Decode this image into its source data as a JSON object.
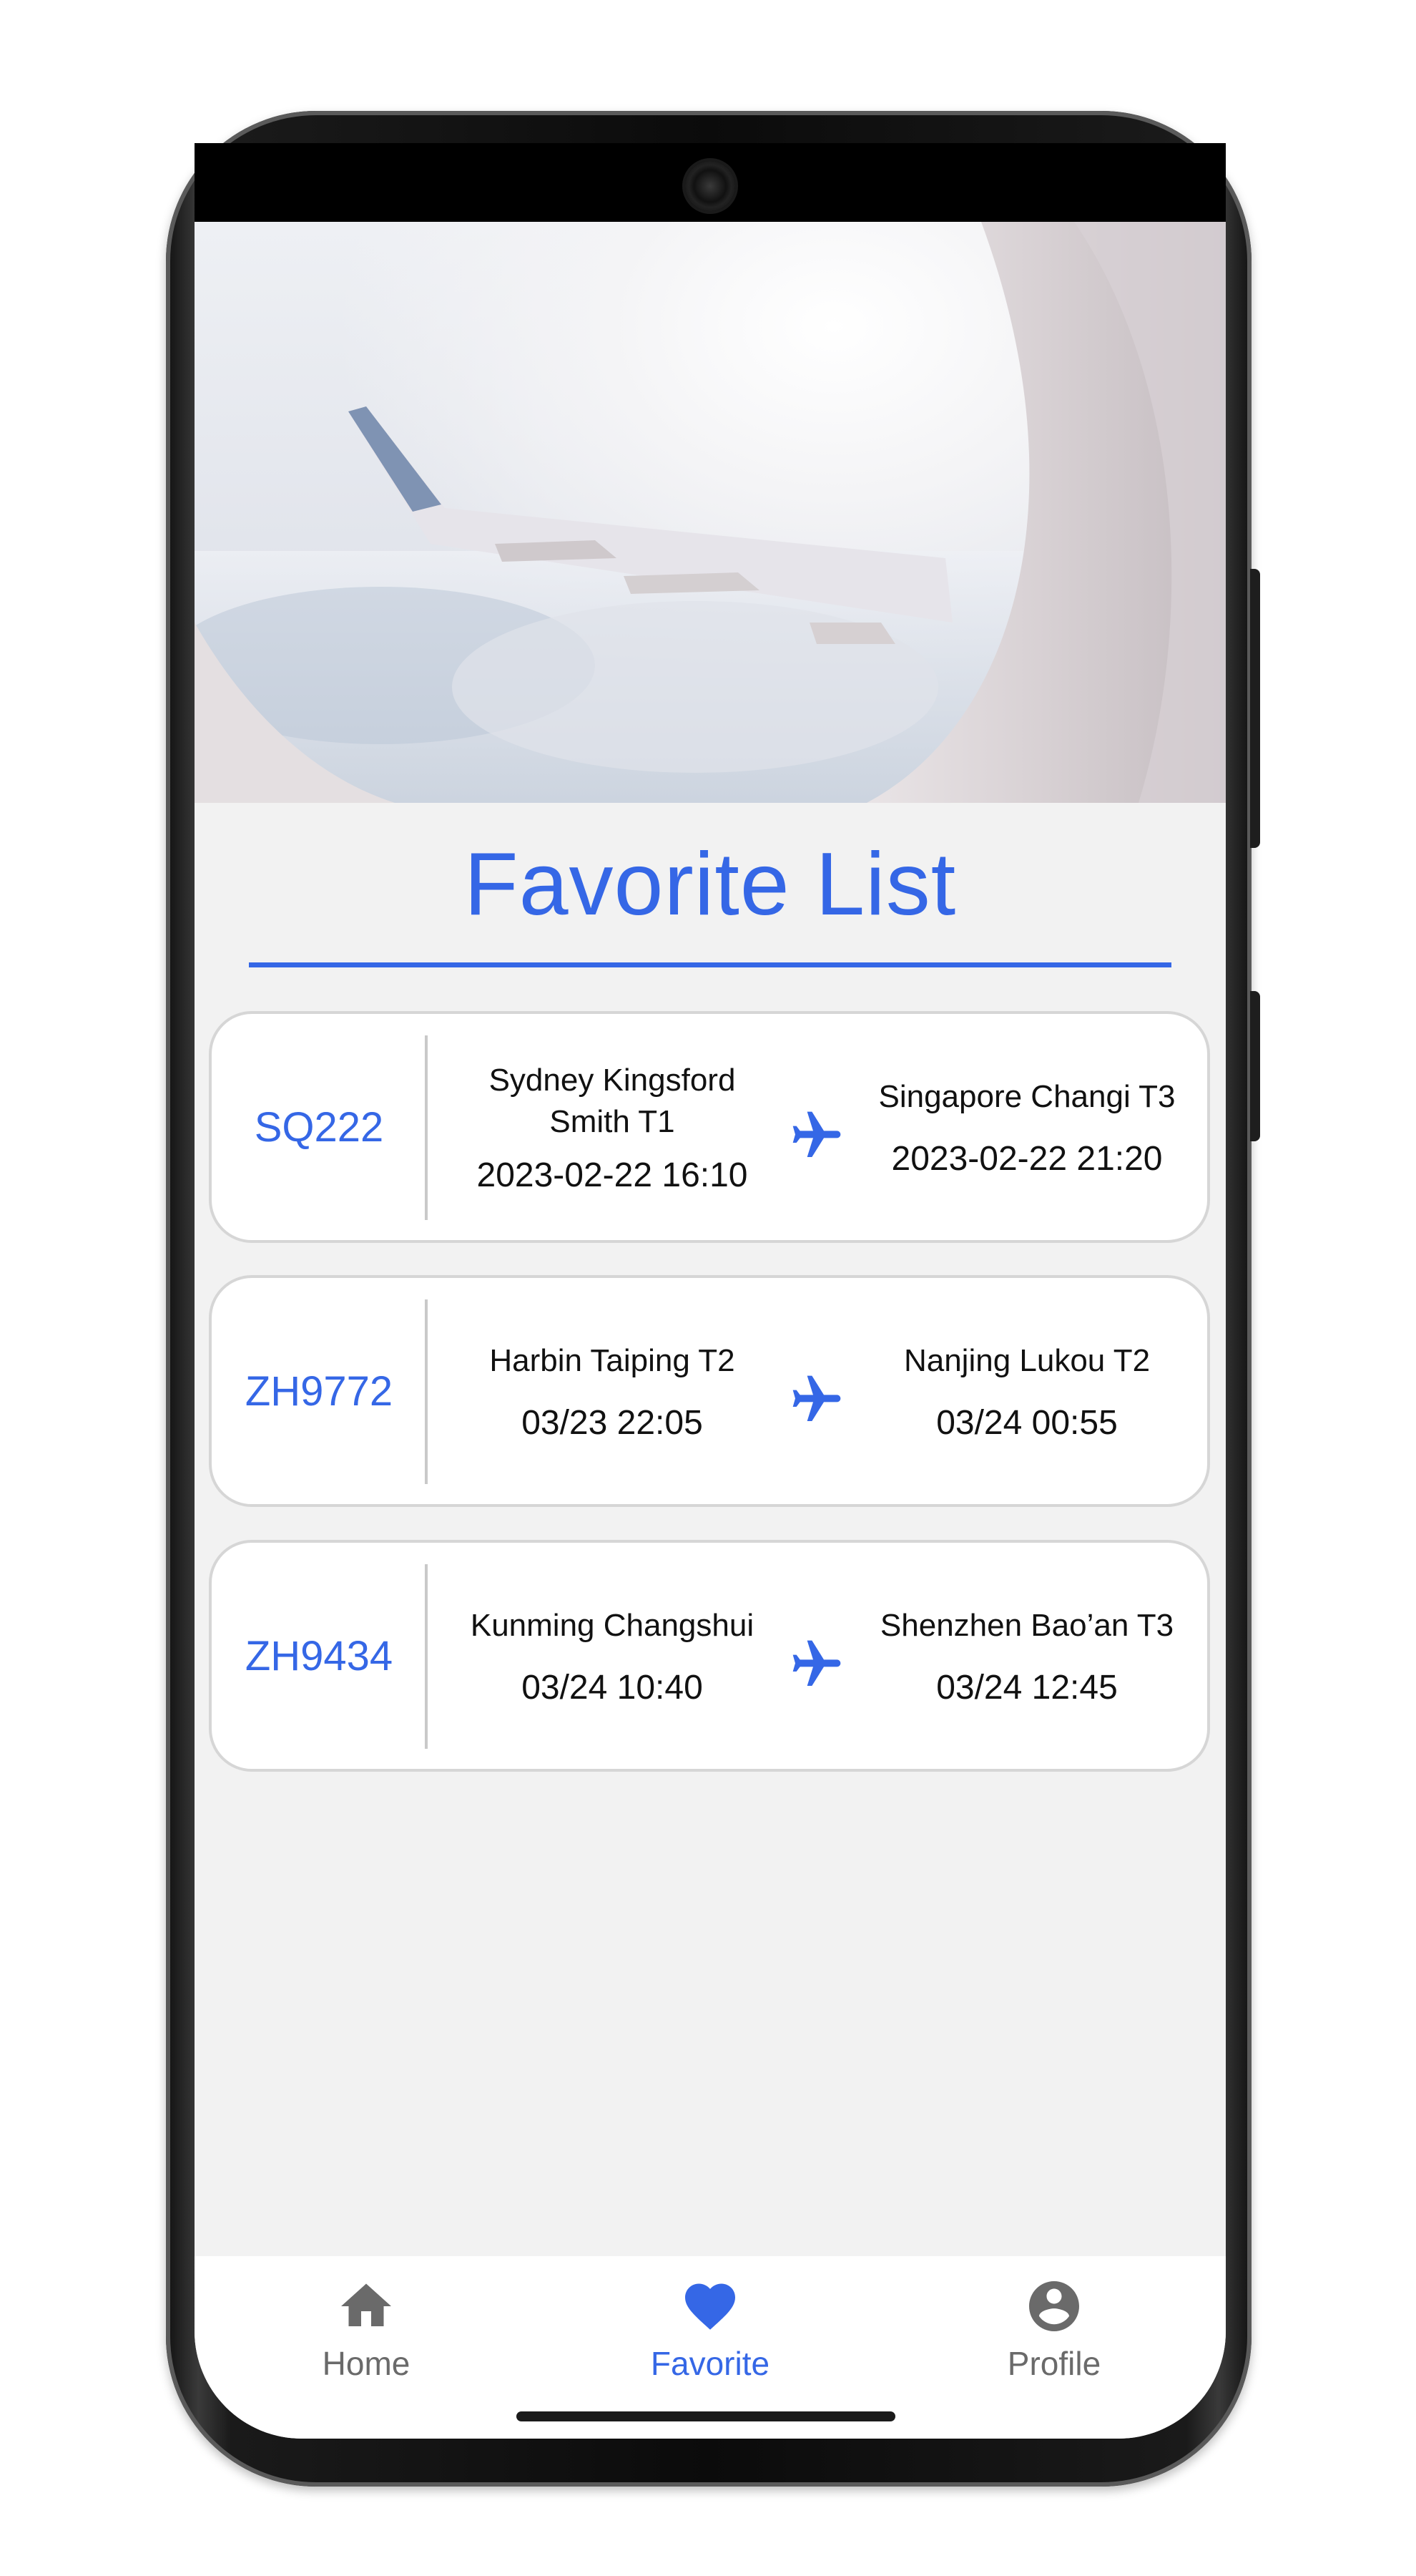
{
  "page": {
    "title": "Favorite List"
  },
  "colors": {
    "accent": "#3567e6",
    "inactive": "#6a6a6a",
    "card_border": "#d6d6d6",
    "background": "#f2f2f2"
  },
  "flights": [
    {
      "code": "SQ222",
      "from_station_1": "Sydney Kingsford",
      "from_station_2": "Smith T1",
      "from_time": "2023-02-22 16:10",
      "to_station": "Singapore Changi T3",
      "to_time": "2023-02-22 21:20",
      "icon": "airplane-icon"
    },
    {
      "code": "ZH9772",
      "from_station": "Harbin Taiping T2",
      "from_time": "03/23 22:05",
      "to_station": "Nanjing Lukou T2",
      "to_time": "03/24 00:55",
      "icon": "airplane-icon"
    },
    {
      "code": "ZH9434",
      "from_station": "Kunming Changshui",
      "from_time": "03/24 10:40",
      "to_station": "Shenzhen Bao’an T3",
      "to_time": "03/24 12:45",
      "icon": "airplane-icon"
    }
  ],
  "nav": {
    "home": {
      "label": "Home",
      "icon": "home-icon"
    },
    "favorite": {
      "label": "Favorite",
      "icon": "heart-icon",
      "active": true
    },
    "profile": {
      "label": "Profile",
      "icon": "account-circle-icon"
    }
  }
}
